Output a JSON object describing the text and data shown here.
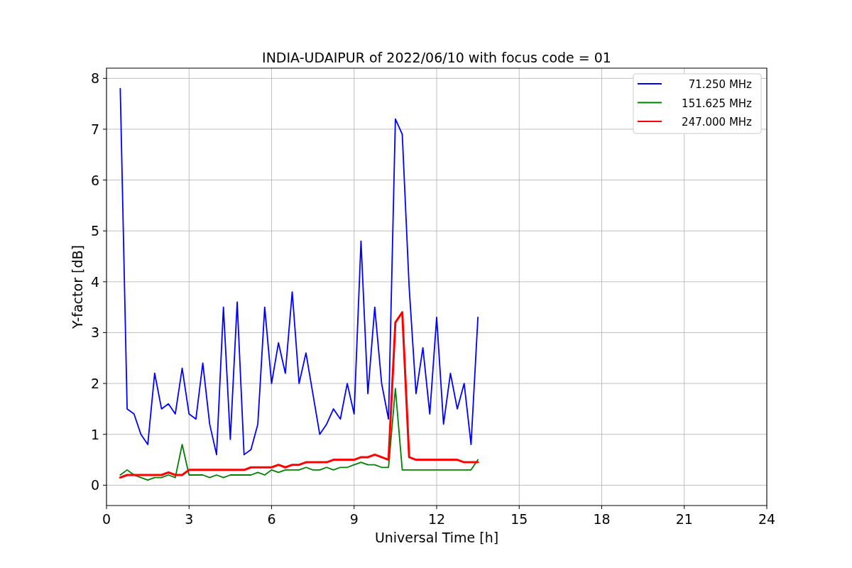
{
  "figure": {
    "chart_data": {
      "type": "line",
      "title": "INDIA-UDAIPUR of 2022/06/10 with focus code = 01",
      "xlabel": "Universal Time [h]",
      "ylabel": "Y-factor [dB]",
      "x": [
        0.5,
        0.75,
        1.0,
        1.25,
        1.5,
        1.75,
        2.0,
        2.25,
        2.5,
        2.75,
        3.0,
        3.25,
        3.5,
        3.75,
        4.0,
        4.25,
        4.5,
        4.75,
        5.0,
        5.25,
        5.5,
        5.75,
        6.0,
        6.25,
        6.5,
        6.75,
        7.0,
        7.25,
        7.5,
        7.75,
        8.0,
        8.25,
        8.5,
        8.75,
        9.0,
        9.25,
        9.5,
        9.75,
        10.0,
        10.25,
        10.5,
        10.75,
        11.0,
        11.25,
        11.5,
        11.75,
        12.0,
        12.25,
        12.5,
        12.75,
        13.0,
        13.25,
        13.5
      ],
      "series": [
        {
          "name": "71.250 MHz",
          "color": "#0000ff",
          "values": [
            7.8,
            1.5,
            1.4,
            1.0,
            0.8,
            2.2,
            1.5,
            1.6,
            1.4,
            2.3,
            1.4,
            1.3,
            2.4,
            1.2,
            0.6,
            3.5,
            0.9,
            3.6,
            0.6,
            0.7,
            1.2,
            3.5,
            2.0,
            2.8,
            2.2,
            3.8,
            2.0,
            2.6,
            1.8,
            1.0,
            1.2,
            1.5,
            1.3,
            2.0,
            1.4,
            4.8,
            1.8,
            3.5,
            2.0,
            1.3,
            7.2,
            6.9,
            3.9,
            1.8,
            2.7,
            1.4,
            3.3,
            1.2,
            2.2,
            1.5,
            2.0,
            0.8,
            3.3
          ]
        },
        {
          "name": "151.625 MHz",
          "color": "#008000",
          "values": [
            0.2,
            0.3,
            0.2,
            0.15,
            0.1,
            0.15,
            0.15,
            0.2,
            0.15,
            0.8,
            0.2,
            0.2,
            0.2,
            0.15,
            0.2,
            0.15,
            0.2,
            0.2,
            0.2,
            0.2,
            0.25,
            0.2,
            0.3,
            0.25,
            0.3,
            0.3,
            0.3,
            0.35,
            0.3,
            0.3,
            0.35,
            0.3,
            0.35,
            0.35,
            0.4,
            0.45,
            0.4,
            0.4,
            0.35,
            0.35,
            1.9,
            0.3,
            0.3,
            0.3,
            0.3,
            0.3,
            0.3,
            0.3,
            0.3,
            0.3,
            0.3,
            0.3,
            0.5
          ]
        },
        {
          "name": "247.000 MHz",
          "color": "#ff0000",
          "values": [
            0.15,
            0.2,
            0.2,
            0.2,
            0.2,
            0.2,
            0.2,
            0.25,
            0.2,
            0.2,
            0.3,
            0.3,
            0.3,
            0.3,
            0.3,
            0.3,
            0.3,
            0.3,
            0.3,
            0.35,
            0.35,
            0.35,
            0.35,
            0.4,
            0.35,
            0.4,
            0.4,
            0.45,
            0.45,
            0.45,
            0.45,
            0.5,
            0.5,
            0.5,
            0.5,
            0.55,
            0.55,
            0.6,
            0.55,
            0.5,
            3.2,
            3.4,
            0.55,
            0.5,
            0.5,
            0.5,
            0.5,
            0.5,
            0.5,
            0.5,
            0.45,
            0.45,
            0.45
          ]
        }
      ],
      "xlim": [
        0,
        24
      ],
      "ylim": [
        -0.4,
        8.2
      ],
      "xticks": [
        0,
        3,
        6,
        9,
        12,
        15,
        18,
        21,
        24
      ],
      "yticks": [
        0,
        1,
        2,
        3,
        4,
        5,
        6,
        7,
        8
      ],
      "grid": true,
      "legend": true
    }
  }
}
